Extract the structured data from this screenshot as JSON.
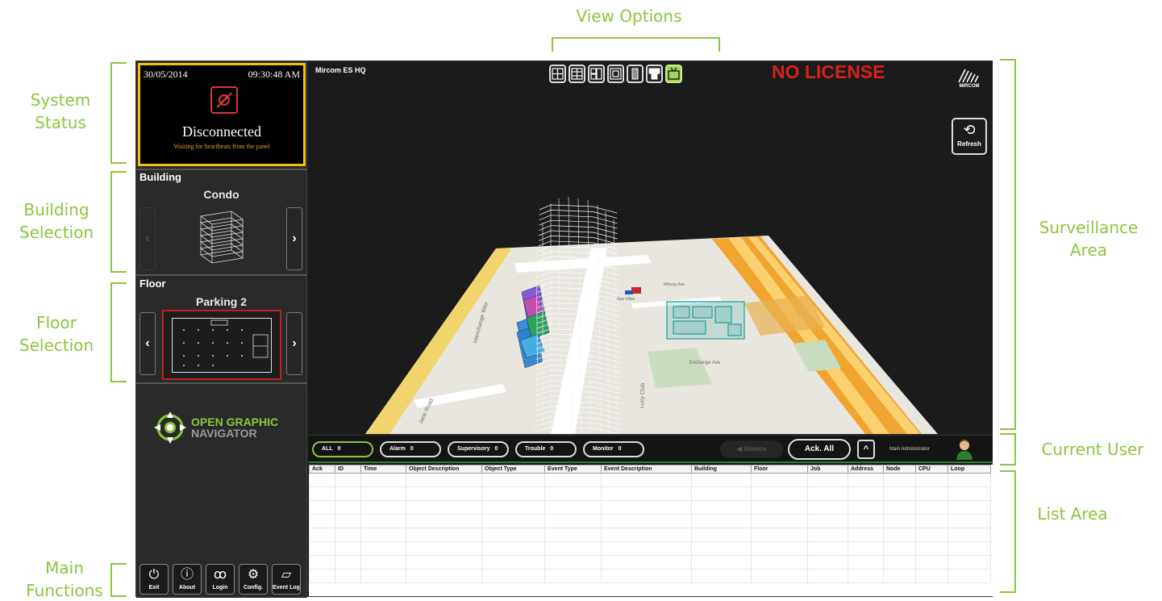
{
  "annotations": {
    "view_options": "View Options",
    "system_status": [
      "System",
      "Status"
    ],
    "building_selection": [
      "Building",
      "Selection"
    ],
    "floor_selection": [
      "Floor",
      "Selection"
    ],
    "main_functions": [
      "Main",
      "Functions"
    ],
    "surveillance_area": [
      "Surveillance",
      "Area"
    ],
    "current_user": "Current User",
    "list_area": "List Area"
  },
  "status": {
    "date": "30/05/2014",
    "time": "09:30:48 AM",
    "state": "Disconnected",
    "message": "Waiting for heartbeats from the panel",
    "icon": "unplugged-icon"
  },
  "building": {
    "title": "Building",
    "name": "Condo"
  },
  "floor": {
    "title": "Floor",
    "name": "Parking 2"
  },
  "logo": {
    "line1": "OPEN GRAPHIC",
    "line2": "NAVIGATOR"
  },
  "functions": [
    {
      "label": "Exit",
      "icon": "power-icon"
    },
    {
      "label": "About",
      "icon": "info-icon"
    },
    {
      "label": "Login",
      "icon": "login-icon"
    },
    {
      "label": "Config.",
      "icon": "gear-icon"
    },
    {
      "label": "Event Log",
      "icon": "event-log-icon"
    }
  ],
  "surveillance": {
    "location": "Mircom ES HQ",
    "license": "NO LICENSE",
    "brand": "MIRCOM",
    "refresh_label": "Refresh",
    "view_active_index": 6
  },
  "map_labels": {
    "road1": "Interchange Way",
    "road2": "Interchange Way",
    "road3": "Exchange Ave",
    "road4": "Lucy Club",
    "road5": "Spa Villas",
    "road6": "Millway Ave",
    "road7": "Jane Road"
  },
  "filters": [
    {
      "label": "ALL",
      "count": "0"
    },
    {
      "label": "Alarm",
      "count": "0"
    },
    {
      "label": "Supervisory",
      "count": "0"
    },
    {
      "label": "Trouble",
      "count": "0"
    },
    {
      "label": "Monitor",
      "count": "0"
    }
  ],
  "eventbar": {
    "silence_label": "Silence",
    "ack_all_label": "Ack. All",
    "expand_label": "^",
    "user": "Main Administrator"
  },
  "list": {
    "columns": [
      "Ack",
      "ID",
      "Time",
      "Object Description",
      "Object Type",
      "Event Type",
      "Event Description",
      "Building",
      "Floor",
      "Job",
      "Address",
      "Node",
      "CPU",
      "Loop"
    ]
  },
  "colors": {
    "accent": "#8cc63f",
    "status_border": "#f2c20b",
    "license": "#d8201a",
    "view_active": "#a5d35a"
  }
}
